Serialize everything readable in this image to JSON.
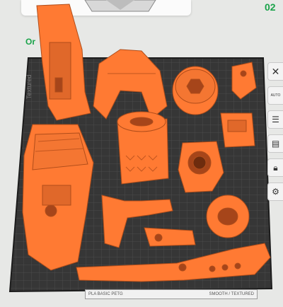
{
  "topbar": {
    "plate_count": "02",
    "orientation_label": "Or"
  },
  "toolbar": {
    "items": [
      "close-icon",
      "auto-arrange-icon",
      "list-icon",
      "layers-icon",
      "lock-icon",
      "settings-icon"
    ],
    "auto_label": "AUTO"
  },
  "plate": {
    "brand_text": "Textured",
    "sheet_label": "PLA BASIC PETG",
    "sheet_label_2": "SMOOTH / TEXTURED"
  },
  "colors": {
    "part": "#ff7a33",
    "plate": "#363636",
    "grid": "#4a4a4a",
    "background": "#e7e8e6",
    "accent": "#1aa34a"
  }
}
